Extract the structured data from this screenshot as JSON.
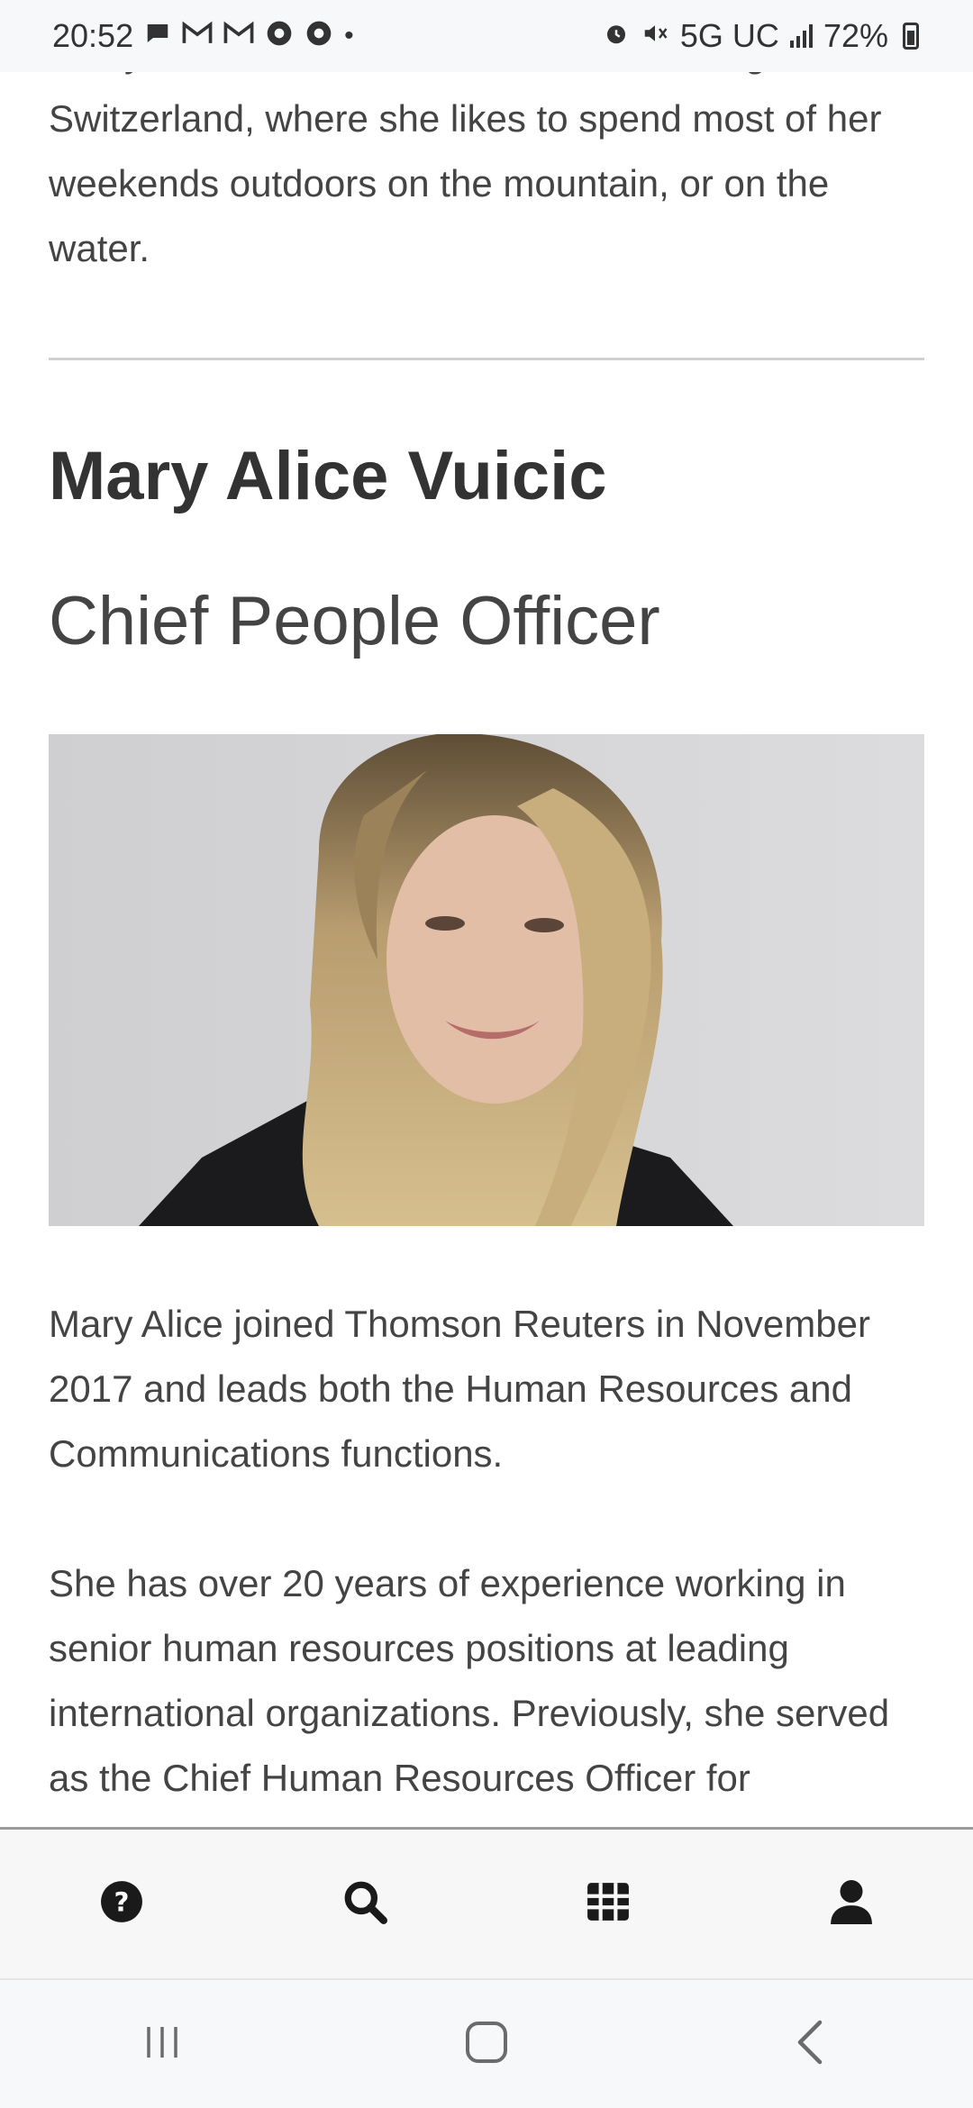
{
  "status_bar": {
    "time": "20:52",
    "network": "5G UC",
    "battery": "72%",
    "left_icons": [
      "chat-icon",
      "gmail-icon",
      "gmail-icon",
      "chrome-icon",
      "chrome-icon",
      "dot-icon"
    ],
    "right_icons": [
      "alarm-icon",
      "mute-icon",
      "signal-icon",
      "battery-icon"
    ]
  },
  "previous_bio": {
    "text": "Kirsty lives with her husband and two daughters in Switzerland, where she likes to spend most of her weekends outdoors on the mountain, or on the water."
  },
  "person": {
    "name": "Mary Alice Vuicic",
    "title": "Chief People Officer",
    "bio": [
      "Mary Alice joined Thomson Reuters in November 2017 and leads both the Human Resources and Communications functions.",
      "She has over 20 years of experience working in senior human resources positions at leading international organizations. Previously, she served as the Chief Human Resources Officer for"
    ]
  },
  "bottom_nav": {
    "items": [
      {
        "icon": "help-icon"
      },
      {
        "icon": "search-icon"
      },
      {
        "icon": "grid-icon"
      },
      {
        "icon": "account-icon"
      }
    ]
  },
  "colors": {
    "text": "#444444",
    "heading": "#333333",
    "divider": "#cfcfcf",
    "nav_bg": "#f7f7f7"
  }
}
